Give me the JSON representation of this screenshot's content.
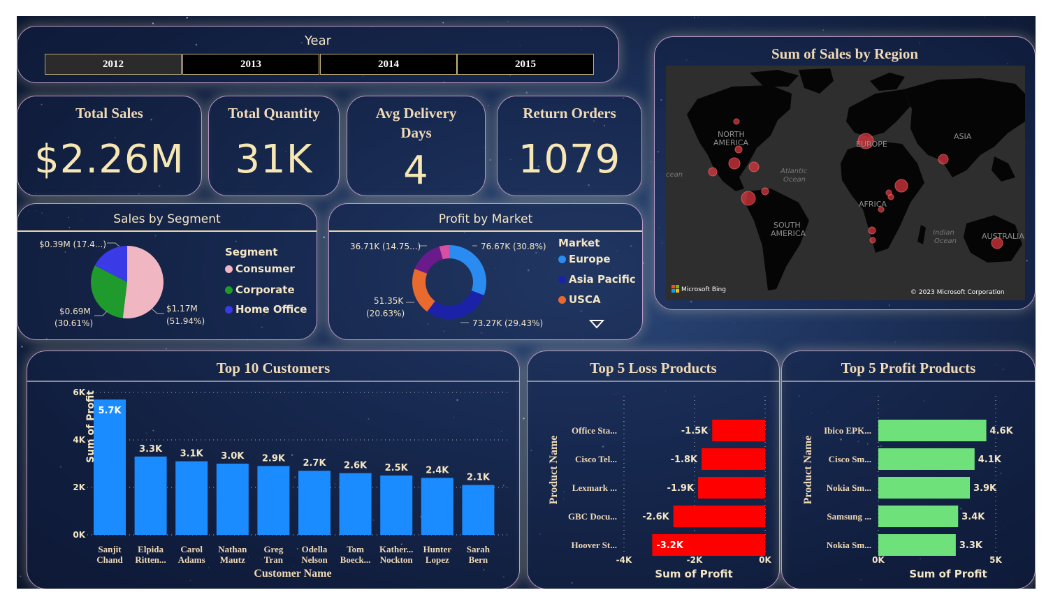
{
  "colors": {
    "bar_blue": "#1b8cff",
    "loss_red": "#ff0000",
    "profit_green": "#6ee17a",
    "consumer": "#f0b6c2",
    "corporate": "#1f9a2c",
    "home_office": "#3a3ae6",
    "europe": "#2a8cf0",
    "asia_pacific": "#1c22a8",
    "usca": "#e86a2e",
    "market_purple": "#6a1a8a",
    "market_pink": "#d64fa0"
  },
  "year_slicer": {
    "title": "Year",
    "options": [
      "2012",
      "2013",
      "2014",
      "2015"
    ],
    "selected": "2012"
  },
  "kpis": {
    "total_sales": {
      "label": "Total Sales",
      "value": "$2.26M"
    },
    "total_quantity": {
      "label": "Total Quantity",
      "value": "31K"
    },
    "avg_delivery": {
      "label_line1": "Avg Delivery",
      "label_line2": "Days",
      "value": "4"
    },
    "return_orders": {
      "label": "Return Orders",
      "value": "1079"
    }
  },
  "segment": {
    "title": "Sales by Segment",
    "legend_title": "Segment",
    "labels": {
      "home_office": "$0.39M (17.4...)",
      "corporate_1": "$0.69M",
      "corporate_2": "(30.61%)",
      "consumer_1": "$1.17M",
      "consumer_2": "(51.94%)"
    },
    "legend": [
      "Consumer",
      "Corporate",
      "Home Office"
    ]
  },
  "market": {
    "title": "Profit by Market",
    "legend_title": "Market",
    "labels": {
      "europe": "76.67K (30.8%)",
      "asia_pacific": "73.27K (29.43%)",
      "usca_1": "51.35K",
      "usca_2": "(20.63%)",
      "other": "36.71K (14.75...)"
    },
    "legend": [
      "Europe",
      "Asia Pacific",
      "USCA"
    ]
  },
  "map": {
    "title": "Sum of Sales by Region",
    "labels": {
      "north_america": "NORTH\nAMERICA",
      "europe": "EUROPE",
      "asia": "ASIA",
      "africa": "AFRICA",
      "south_america": "SOUTH\nAMERICA",
      "australia": "AUSTRALIA",
      "atlantic": "Atlantic\nOcean",
      "indian": "Indian\nOcean",
      "ocean_left": "cean"
    },
    "bing": "Microsoft Bing",
    "copyright": "© 2023 Microsoft Corporation"
  },
  "top_customers": {
    "title": "Top 10 Customers",
    "xlabel": "Customer Name",
    "ylabel": "Sum of Profit"
  },
  "loss_products": {
    "title": "Top 5 Loss Products",
    "xlabel": "Sum of Profit",
    "ylabel": "Product Name"
  },
  "profit_products": {
    "title": "Top 5 Profit Products",
    "xlabel": "Sum of Profit",
    "ylabel": "Product Name"
  },
  "chart_data": [
    {
      "type": "bar",
      "title": "Top 10 Customers",
      "xlabel": "Customer Name",
      "ylabel": "Sum of Profit",
      "categories": [
        "Sanjit Chand",
        "Elpida Ritten...",
        "Carol Adams",
        "Nathan Mautz",
        "Greg Tran",
        "Odella Nelson",
        "Tom Boeck...",
        "Kather... Nockton",
        "Hunter Lopez",
        "Sarah Bern"
      ],
      "category_lines": [
        [
          "Sanjit",
          "Chand"
        ],
        [
          "Elpida",
          "Ritten..."
        ],
        [
          "Carol",
          "Adams"
        ],
        [
          "Nathan",
          "Mautz"
        ],
        [
          "Greg",
          "Tran"
        ],
        [
          "Odella",
          "Nelson"
        ],
        [
          "Tom",
          "Boeck..."
        ],
        [
          "Kather...",
          "Nockton"
        ],
        [
          "Hunter",
          "Lopez"
        ],
        [
          "Sarah",
          "Bern"
        ]
      ],
      "values": [
        5700,
        3300,
        3100,
        3000,
        2900,
        2700,
        2600,
        2500,
        2400,
        2100
      ],
      "value_labels": [
        "5.7K",
        "3.3K",
        "3.1K",
        "3.0K",
        "2.9K",
        "2.7K",
        "2.6K",
        "2.5K",
        "2.4K",
        "2.1K"
      ],
      "ylim": [
        0,
        6000
      ],
      "yticks": [
        0,
        2000,
        4000,
        6000
      ],
      "ytick_labels": [
        "0K",
        "2K",
        "4K",
        "6K"
      ],
      "grid": true
    },
    {
      "type": "bar",
      "orientation": "horizontal",
      "title": "Top 5 Loss Products",
      "xlabel": "Sum of Profit",
      "ylabel": "Product Name",
      "categories": [
        "Office Sta...",
        "Cisco Tel...",
        "Lexmark ...",
        "GBC Docu...",
        "Hoover St..."
      ],
      "values": [
        -1500,
        -1800,
        -1900,
        -2600,
        -3200
      ],
      "value_labels": [
        "-1.5K",
        "-1.8K",
        "-1.9K",
        "-2.6K",
        "-3.2K"
      ],
      "xlim": [
        -4000,
        0
      ],
      "xticks": [
        -4000,
        -2000,
        0
      ],
      "xtick_labels": [
        "-4K",
        "-2K",
        "0K"
      ],
      "grid": true
    },
    {
      "type": "bar",
      "orientation": "horizontal",
      "title": "Top 5 Profit Products",
      "xlabel": "Sum of Profit",
      "ylabel": "Product Name",
      "categories": [
        "Ibico EPK...",
        "Cisco Sm...",
        "Nokia Sm...",
        "Samsung ...",
        "Nokia Sm..."
      ],
      "values": [
        4600,
        4100,
        3900,
        3400,
        3300
      ],
      "value_labels": [
        "4.6K",
        "4.1K",
        "3.9K",
        "3.4K",
        "3.3K"
      ],
      "xlim": [
        0,
        5000
      ],
      "xticks": [
        0,
        5000
      ],
      "xtick_labels": [
        "0K",
        "5K"
      ],
      "grid": true
    },
    {
      "type": "pie",
      "title": "Sales by Segment",
      "categories": [
        "Consumer",
        "Corporate",
        "Home Office"
      ],
      "values": [
        51.94,
        30.61,
        17.45
      ]
    },
    {
      "type": "pie",
      "title": "Profit by Market",
      "categories": [
        "Europe",
        "Asia Pacific",
        "USCA",
        "",
        ""
      ],
      "values": [
        30.8,
        29.43,
        20.63,
        14.75,
        4.39
      ]
    }
  ]
}
